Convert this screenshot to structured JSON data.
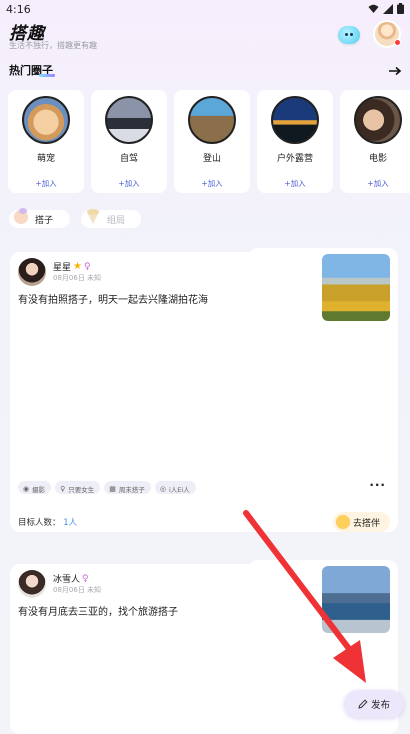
{
  "status": {
    "time": "4:16"
  },
  "header": {
    "title": "搭趣",
    "subtitle": "生活不独行，搭趣更有趣"
  },
  "section": {
    "hot_circles_title": "热门圈子"
  },
  "circles": [
    {
      "name": "萌宠",
      "join": "+加入"
    },
    {
      "name": "自驾",
      "join": "+加入"
    },
    {
      "name": "登山",
      "join": "+加入"
    },
    {
      "name": "户外露营",
      "join": "+加入"
    },
    {
      "name": "电影",
      "join": "+加入"
    }
  ],
  "filters": [
    {
      "label": "搭子",
      "active": true
    },
    {
      "label": "组局",
      "active": false
    }
  ],
  "posts": [
    {
      "name": "星星",
      "meta": "08月06日 未知",
      "text": "有没有拍照搭子，明天一起去兴隆湖拍花海",
      "tags": [
        "摄影",
        "只要女生",
        "周末搭子",
        "i人Ei人"
      ],
      "target_label": "目标人数：",
      "target_value": "1人",
      "join_label": "去搭伴"
    },
    {
      "name": "冰雪人",
      "meta": "08月06日 未知",
      "text": "有没有月底去三亚的，找个旅游搭子"
    }
  ],
  "fab": {
    "publish": "发布"
  },
  "colors": {
    "accent": "#4a5ad6",
    "arrow": "#ee3236"
  }
}
